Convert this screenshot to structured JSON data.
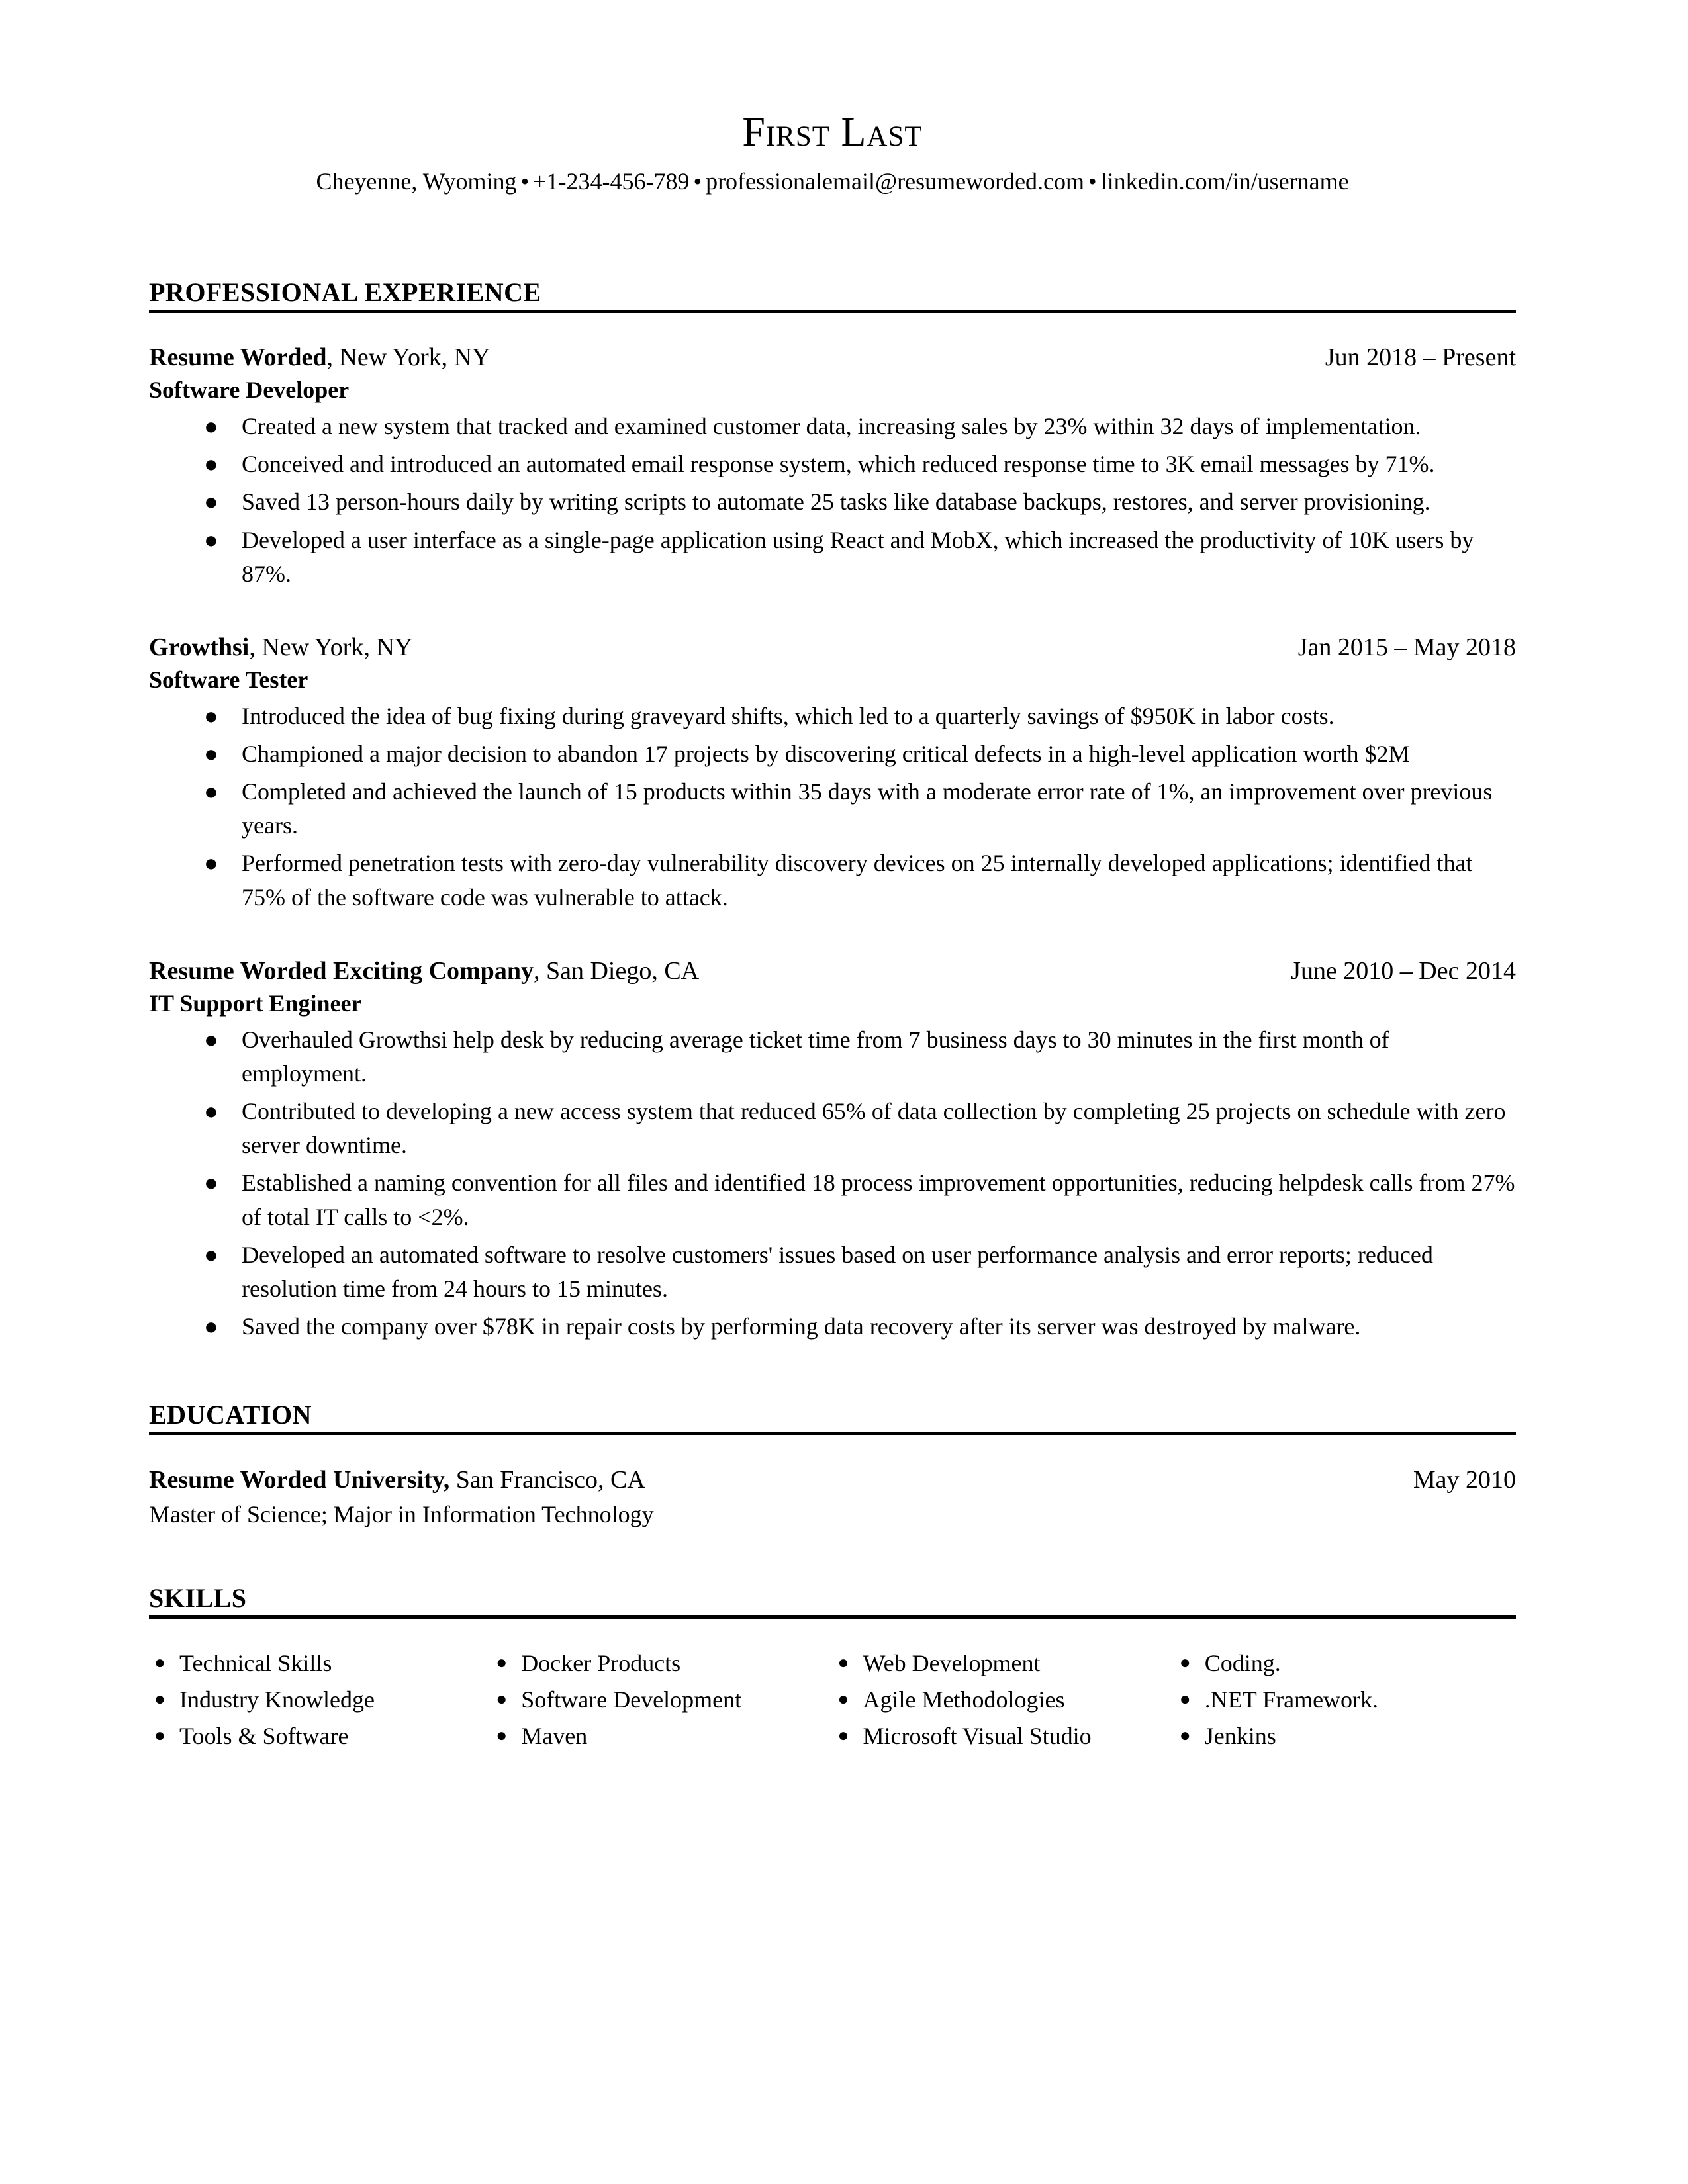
{
  "header": {
    "name": "First Last",
    "contact": {
      "location": "Cheyenne, Wyoming",
      "phone": "+1-234-456-789",
      "email": "professionalemail@resumeworded.com",
      "linkedin": "linkedin.com/in/username",
      "separator": "•"
    }
  },
  "sections": {
    "experience": {
      "heading": "PROFESSIONAL EXPERIENCE",
      "entries": [
        {
          "org_name": "Resume Worded",
          "org_location": ", New York, NY",
          "date": "Jun 2018 – Present",
          "role": "Software Developer",
          "bullets": [
            "Created a new system that tracked and examined customer data, increasing sales by 23% within 32 days of implementation.",
            "Conceived and introduced an automated email response system, which reduced response time to 3K email messages by 71%.",
            "Saved 13 person-hours daily by writing scripts to automate 25 tasks like database backups, restores, and server provisioning.",
            "Developed a user interface as a single-page application using React and MobX, which increased the productivity of 10K users by 87%."
          ]
        },
        {
          "org_name": "Growthsi",
          "org_location": ", New York, NY",
          "date": "Jan 2015 – May 2018",
          "role": "Software Tester",
          "bullets": [
            "Introduced the idea of bug fixing during graveyard shifts, which led to a quarterly savings of $950K in labor costs.",
            "Championed a major decision to abandon 17 projects by discovering critical defects in a high-level application worth $2M",
            "Completed and achieved the launch of 15 products within 35 days with a moderate error rate of 1%, an improvement over previous years.",
            "Performed penetration tests with zero-day vulnerability discovery devices on 25 internally developed applications; identified that 75% of the software code was vulnerable to attack."
          ]
        },
        {
          "org_name": "Resume Worded Exciting Company",
          "org_location": ", San Diego, CA",
          "date": "June 2010 – Dec 2014",
          "role": "IT Support Engineer",
          "bullets": [
            "Overhauled Growthsi help desk by reducing average ticket time from 7 business days to 30 minutes in the first month of employment.",
            "Contributed to developing a new access system that reduced 65% of data collection by completing 25 projects on schedule with zero server downtime.",
            "Established a naming convention for all files and identified 18 process improvement opportunities, reducing helpdesk calls from 27% of total IT calls to <2%.",
            "Developed an automated software to resolve customers' issues based on user performance analysis and error reports; reduced resolution time from 24 hours to 15 minutes.",
            "Saved the company over $78K in repair costs by performing data recovery after its server was destroyed by malware."
          ]
        }
      ]
    },
    "education": {
      "heading": "EDUCATION",
      "entries": [
        {
          "org_name": "Resume Worded University,",
          "org_location": " San Francisco, CA",
          "date": "May 2010",
          "detail": "Master of Science; Major in Information Technology"
        }
      ]
    },
    "skills": {
      "heading": "SKILLS",
      "columns": [
        [
          "Technical Skills",
          "Industry Knowledge",
          "Tools & Software"
        ],
        [
          "Docker Products",
          "Software Development",
          "Maven"
        ],
        [
          "Web Development",
          "Agile Methodologies",
          "Microsoft Visual Studio"
        ],
        [
          "Coding.",
          ".NET Framework.",
          "Jenkins"
        ]
      ]
    }
  }
}
